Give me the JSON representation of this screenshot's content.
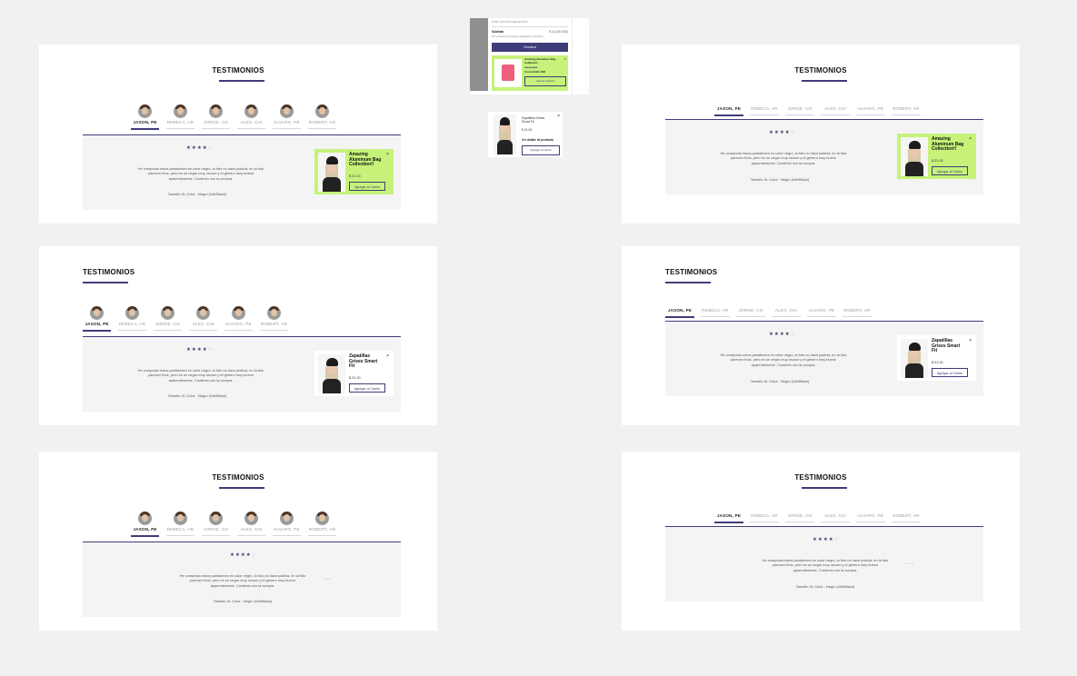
{
  "section_title": "TESTIMONIOS",
  "tabs": [
    "JASON, PE",
    "REBECA, AR",
    "JORGE, CO",
    "ALEX, CHI",
    "ALVARO, PE",
    "ROBERT, AR"
  ],
  "rating": {
    "filled": 4,
    "total": 5,
    "filled_glyph": "★★★★",
    "empty_glyph": "☆"
  },
  "review_text": "He comprado estos pantalones en color negro, la foto no hace justicia, en la foto parecen fríos, pero es un negro muy oscuro y el género muy bueno aparentemente. Contento con la compra.",
  "review_meta": "Tamaño XL Color : Negro (Volt/Black)",
  "review_meta_alt": "Tamaño XL Color : Negro (Volt/Black)",
  "popup_green": {
    "name": "Amazing Aluminum Bag Collection!!",
    "price": "$ 21.00",
    "button": "Agregar al Carrito",
    "close": "×"
  },
  "popup_white": {
    "name": "Zapatillas Grises Smart Fit",
    "price": "$ 21.00",
    "button": "Agregar al Carrito",
    "close": "×"
  },
  "dots": "···",
  "cart_mini": {
    "row1": "Enter your promotional here",
    "subtotal_label": "Subtotal",
    "subtotal_value": "$ 112,00 USD",
    "note": "Tax included and shipping calculated at checkout",
    "checkout": "Checkout",
    "product_name": "Amazing Aluminum Bag Collection",
    "product_old": "$36.00 USD",
    "product_price": "From 24.00 USD",
    "product_button": "Choose options"
  },
  "popup_mini": {
    "name": "Zapatillas Grises Smart Fit",
    "price": "$ 21.00",
    "note": "Ver detalle de producto",
    "button": "Agregar al carrito",
    "close": "×"
  },
  "colors": {
    "accent": "#3f3c7a",
    "promo_green": "#c6f27a",
    "panel": "#f4f4f4",
    "page_bg": "#f1f1f1"
  }
}
